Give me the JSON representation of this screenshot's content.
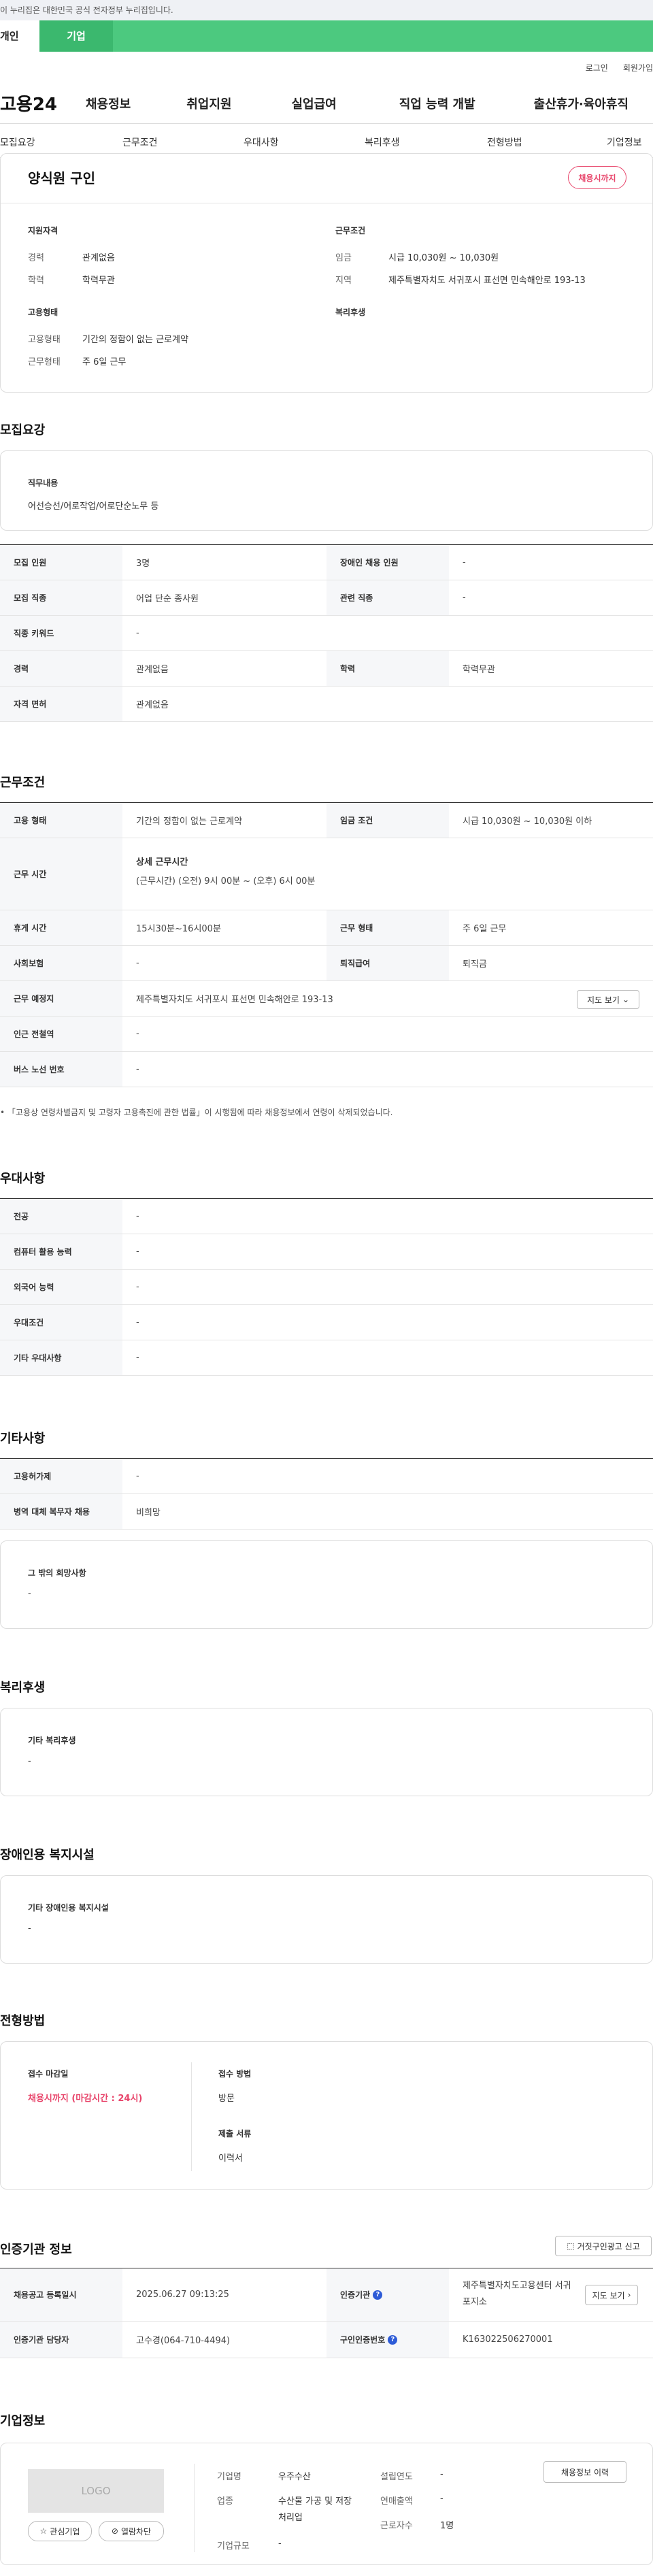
{
  "gov_banner": "이 누리집은 대한민국 공식 전자정부 누리집입니다.",
  "persona": {
    "individual": "개인",
    "company": "기업"
  },
  "util": {
    "login": "로그인",
    "signup": "회원가입"
  },
  "gnb": {
    "logo": "고용24",
    "menus": [
      "채용정보",
      "취업지원",
      "실업급여",
      "직업 능력 개발",
      "출산휴가·육아휴직"
    ]
  },
  "lnb": [
    "모집요강",
    "근무조건",
    "우대사항",
    "복리후생",
    "전형방법",
    "기업정보"
  ],
  "job": {
    "title": "양식원 구인",
    "status": "채용시까지",
    "summary": {
      "qual_title": "지원자격",
      "career_l": "경력",
      "career_v": "관계없음",
      "edu_l": "학력",
      "edu_v": "학력무관",
      "emp_title": "고용형태",
      "type_l": "고용형태",
      "type_v": "기간의 정함이 없는 근로계약",
      "form_l": "근무형태",
      "form_v": "주 6일 근무",
      "cond_title": "근무조건",
      "wage_l": "임금",
      "wage_v": "시급 10,030원 ~ 10,030원",
      "area_l": "지역",
      "area_v": "제주특별자치도 서귀포시 표선면 민속해안로 193-13",
      "welfare_title": "복리후생"
    }
  },
  "recruit": {
    "heading": "모집요강",
    "duty_title": "직무내용",
    "duty_value": "어선승선/어로작업/어로단순노무 등",
    "rows": [
      {
        "k1": "모집 인원",
        "v1": "3명",
        "k2": "장애인 채용 인원",
        "v2": "-"
      },
      {
        "k1": "모집 직종",
        "v1": "어업 단순 종사원",
        "k2": "관련 직종",
        "v2": "-"
      },
      {
        "k1": "직종 키워드",
        "v1": "-"
      },
      {
        "k1": "경력",
        "v1": "관계없음",
        "k2": "학력",
        "v2": "학력무관"
      },
      {
        "k1": "자격 면허",
        "v1": "관계없음"
      }
    ]
  },
  "work": {
    "heading": "근무조건",
    "type_k": "고용 형태",
    "type_v": "기간의 정함이 없는 근로계약",
    "wage_k": "임금 조건",
    "wage_v": "시급 10,030원 ~ 10,030원 이하",
    "hours_k": "근무 시간",
    "hours_t": "상세 근무시간",
    "hours_v": "(근무시간) (오전) 9시 00분 ~ (오후) 6시 00분",
    "rest_k": "휴게 시간",
    "rest_v": "15시30분~16시00분",
    "form_k": "근무 형태",
    "form_v": "주 6일 근무",
    "ins_k": "사회보험",
    "ins_v": "-",
    "ret_k": "퇴직급여",
    "ret_v": "퇴직금",
    "place_k": "근무 예정지",
    "place_v": "제주특별자치도 서귀포시 표선면 민속해안로 193-13",
    "map_btn": "지도 보기",
    "station_k": "인근 전철역",
    "station_v": "-",
    "bus_k": "버스 노선 번호",
    "bus_v": "-",
    "note": "「고용상 연령차별금지 및 고령자 고용촉진에 관한 법률」이 시행됨에 따라 채용정보에서 연령이 삭제되었습니다."
  },
  "pref": {
    "heading": "우대사항",
    "rows": [
      {
        "k": "전공",
        "v": "-"
      },
      {
        "k": "컴퓨터 활용 능력",
        "v": "-"
      },
      {
        "k": "외국어 능력",
        "v": "-"
      },
      {
        "k": "우대조건",
        "v": "-"
      },
      {
        "k": "기타 우대사항",
        "v": "-"
      }
    ]
  },
  "etc": {
    "heading": "기타사항",
    "rows": [
      {
        "k": "고용허가제",
        "v": "-"
      },
      {
        "k": "병역 대체 복무자 채용",
        "v": "비희망"
      }
    ],
    "wish_title": "그 밖의 희망사항",
    "wish_v": "-"
  },
  "welfare": {
    "heading": "복리후생",
    "title": "기타 복리후생",
    "v": "-"
  },
  "disabled": {
    "heading": "장애인용 복지시설",
    "title": "기타 장애인용 복지시설",
    "v": "-"
  },
  "process": {
    "heading": "전형방법",
    "deadline_t": "접수 마감일",
    "deadline_v": "채용시까지 (마감시간 : 24시)",
    "method_t": "접수 방법",
    "method_v": "방문",
    "docs_t": "제출 서류",
    "docs_v": "이력서"
  },
  "cert": {
    "heading": "인증기관 정보",
    "report_btn": "거짓구인광고 신고",
    "reg_k": "채용공고 등록일시",
    "reg_v": "2025.06.27 09:13:25",
    "org_k": "인증기관",
    "org_v": "제주특별자치도고용센터 서귀포지소",
    "map_btn": "지도 보기",
    "mgr_k": "인증기관 담당자",
    "mgr_v": "고수경(064-710-4494)",
    "num_k": "구인인증번호",
    "num_v": "K163022506270001"
  },
  "company": {
    "heading": "기업정보",
    "logo": "LOGO",
    "fav": "관심기업",
    "block": "열람차단",
    "name_l": "기업명",
    "name_v": "우주수산",
    "ind_l": "업종",
    "ind_v": "수산물 가공 및 저장 처리업",
    "size_l": "기업규모",
    "size_v": "-",
    "year_l": "설립연도",
    "year_v": "-",
    "sales_l": "연매출액",
    "sales_v": "-",
    "emp_l": "근로자수",
    "emp_v": "1명",
    "jobs_btn": "채용정보 이력"
  },
  "colors": {
    "green": "#4cc97f",
    "pink": "#e8456b",
    "blue": "#2d5bd7"
  }
}
